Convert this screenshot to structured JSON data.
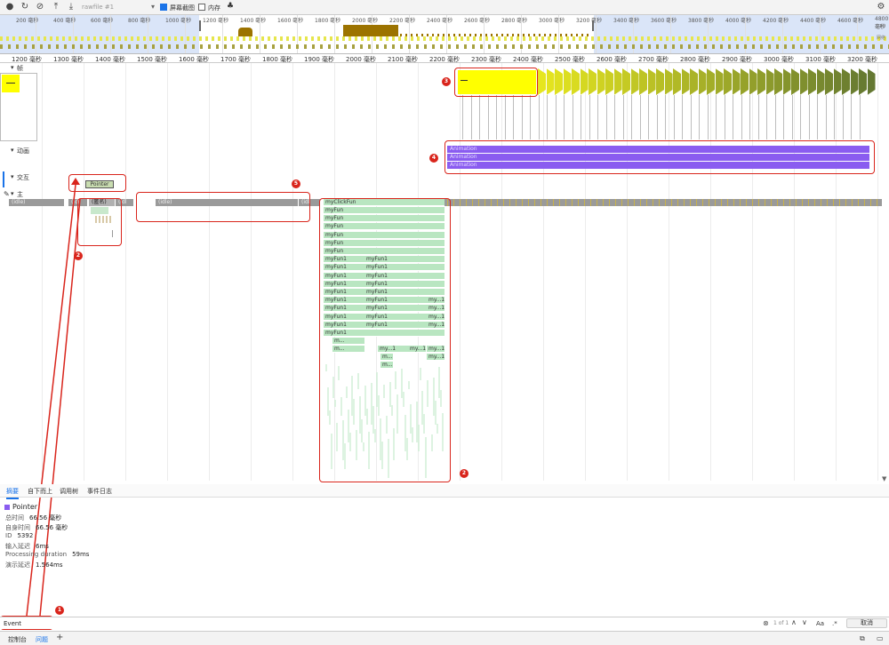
{
  "toolbar": {
    "record_label": "●",
    "reload_label": "↻",
    "clear_label": "⊘",
    "upload_label": "⤒",
    "download_label": "⤓",
    "recording_select": "rawfile #1",
    "screenshots_label": "屏幕截图",
    "screenshots_checked": true,
    "memory_label": "内存",
    "memory_checked": false,
    "settings_label": "⚙"
  },
  "overview": {
    "ticks": [
      "200 毫秒",
      "400 毫秒",
      "600 毫秒",
      "800 毫秒",
      "1000 毫秒",
      "1200 毫秒",
      "1400 毫秒",
      "1600 毫秒",
      "1800 毫秒",
      "2000 毫秒",
      "2200 毫秒",
      "2400 毫秒",
      "2600 毫秒",
      "2800 毫秒",
      "3000 毫秒",
      "3200 毫秒",
      "3400 毫秒",
      "3600 毫秒",
      "3800 毫秒",
      "4000 毫秒",
      "4200 毫秒",
      "4400 毫秒",
      "4600 毫秒",
      "4800 毫秒"
    ],
    "cpu_label": "CPU",
    "net_label": "网络"
  },
  "ruler": {
    "ticks": [
      "1200 毫秒",
      "1300 毫秒",
      "1400 毫秒",
      "1500 毫秒",
      "1600 毫秒",
      "1700 毫秒",
      "1800 毫秒",
      "1900 毫秒",
      "2000 毫秒",
      "2100 毫秒",
      "2200 毫秒",
      "2300 毫秒",
      "2400 毫秒",
      "2500 毫秒",
      "2600 毫秒",
      "2700 毫秒",
      "2800 毫秒",
      "2900 毫秒",
      "3000 毫秒",
      "3100 毫秒",
      "3200 毫秒"
    ]
  },
  "tracks": {
    "frames": "帧",
    "animation": "动画",
    "interactions": "交互",
    "main": "主"
  },
  "interaction": {
    "label": "Pointer"
  },
  "animations": [
    "Animation",
    "Animation",
    "Animation"
  ],
  "main_thread": {
    "idle_label": "(idle)",
    "idle_short": "(idl",
    "anon_label": "(匿名)",
    "click_fn": "myClickFun",
    "fun": "myFun",
    "fun1": "myFun1",
    "my1": "my...1",
    "m_short": "m...",
    "my_short": "my...1"
  },
  "annotations": [
    "1",
    "2",
    "3",
    "4",
    "5",
    "2"
  ],
  "detail_tabs": [
    "摘要",
    "自下而上",
    "调用树",
    "事件日志"
  ],
  "details": {
    "title": "Pointer",
    "color": "#8a5cf0",
    "rows": [
      {
        "label": "总时间",
        "value": "66.56 毫秒"
      },
      {
        "label": "自身时间",
        "value": "66.56 毫秒"
      },
      {
        "label": "ID",
        "value": "5392"
      },
      {
        "label": "输入延迟",
        "value": "6ms"
      },
      {
        "label": "Processing duration",
        "value": "59ms"
      },
      {
        "label": "演示延迟",
        "value": "1.564ms"
      }
    ]
  },
  "search": {
    "query": "Event",
    "result_count": "1 of 1",
    "match_case": "Aa",
    "regex": ".*",
    "cancel_label": "取消"
  },
  "drawer": {
    "tabs": [
      "控制台",
      "问题"
    ],
    "add_label": "+"
  }
}
